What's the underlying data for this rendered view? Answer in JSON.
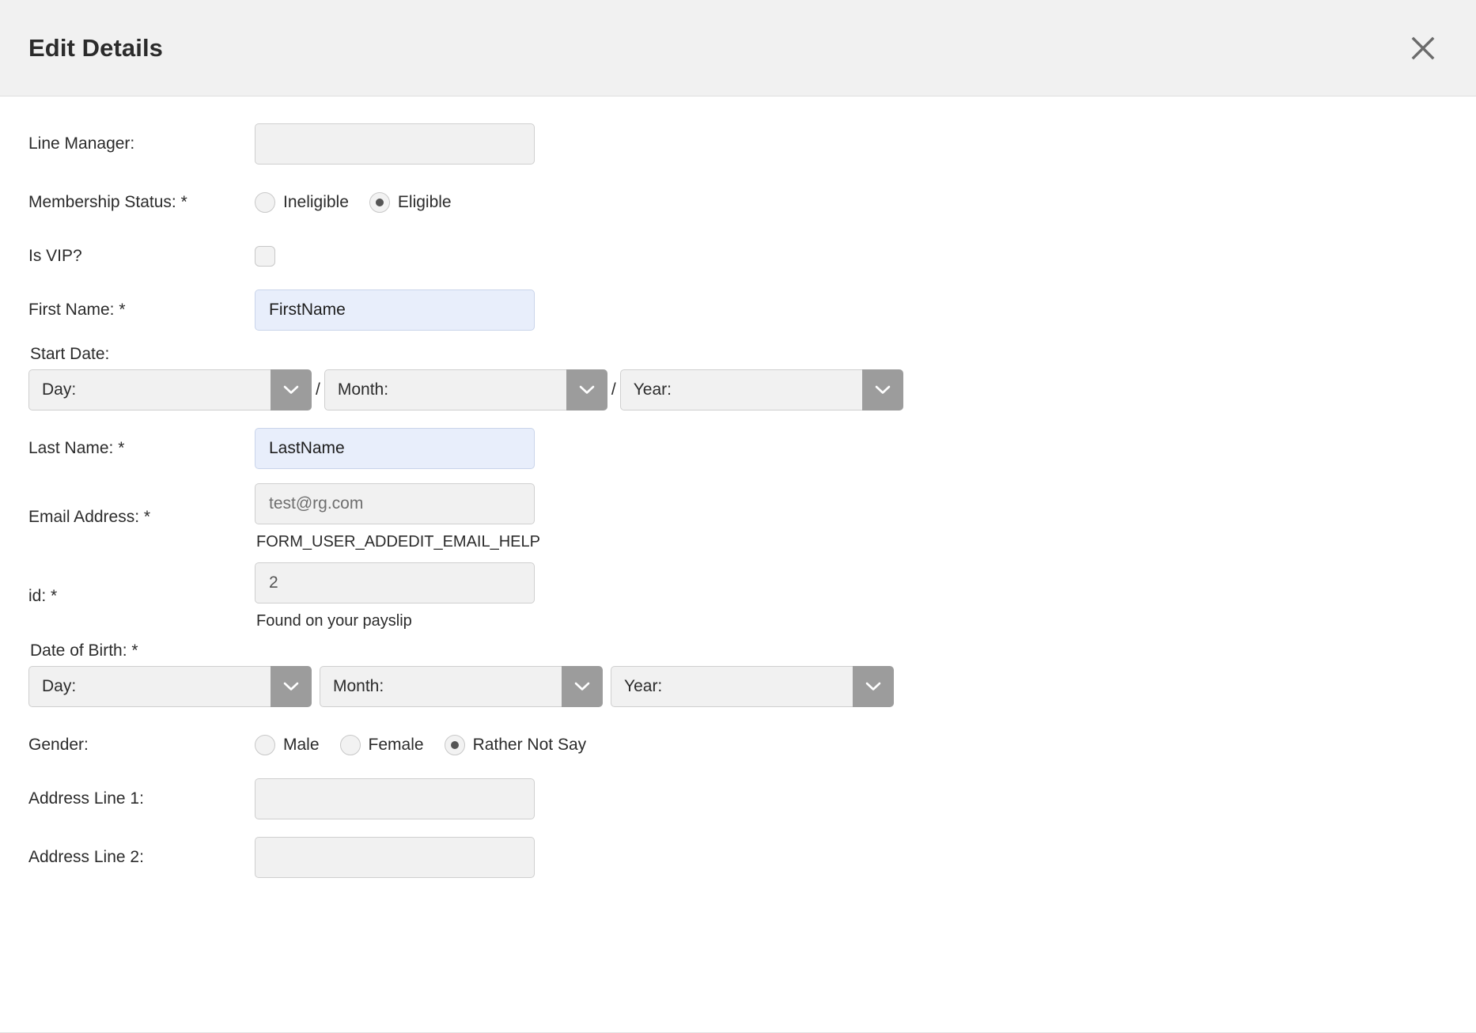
{
  "dialog": {
    "title": "Edit Details",
    "close_icon": "close-icon"
  },
  "fields": {
    "line_manager": {
      "label": "Line Manager:",
      "value": "",
      "placeholder": ""
    },
    "membership_status": {
      "label": "Membership Status: *",
      "options": [
        "Ineligible",
        "Eligible"
      ],
      "selected": "Eligible"
    },
    "is_vip": {
      "label": "Is VIP?",
      "checked": false
    },
    "first_name": {
      "label": "First Name: *",
      "value": "FirstName",
      "placeholder": ""
    },
    "start_date": {
      "label": "Start Date:",
      "day": "Day:",
      "month": "Month:",
      "year": "Year:",
      "separator": "/"
    },
    "last_name": {
      "label": "Last Name: *",
      "value": "LastName",
      "placeholder": ""
    },
    "email": {
      "label": "Email Address: *",
      "value": "",
      "placeholder": "test@rg.com",
      "help": "FORM_USER_ADDEDIT_EMAIL_HELP"
    },
    "id": {
      "label": "id: *",
      "value": "2",
      "placeholder": "",
      "help": "Found on your payslip"
    },
    "date_of_birth": {
      "label": "Date of Birth: *",
      "day": "Day:",
      "month": "Month:",
      "year": "Year:"
    },
    "gender": {
      "label": "Gender:",
      "options": [
        "Male",
        "Female",
        "Rather Not Say"
      ],
      "selected": "Rather Not Say"
    },
    "address_line_1": {
      "label": "Address Line 1:",
      "value": "",
      "placeholder": ""
    },
    "address_line_2": {
      "label": "Address Line 2:",
      "value": "",
      "placeholder": ""
    }
  },
  "colors": {
    "header_bg": "#f1f1f1",
    "input_bg": "#f1f1f1",
    "input_filled_bg": "#e8eefb",
    "select_arrow_bg": "#9c9c9c",
    "text": "#2b2b2b"
  }
}
